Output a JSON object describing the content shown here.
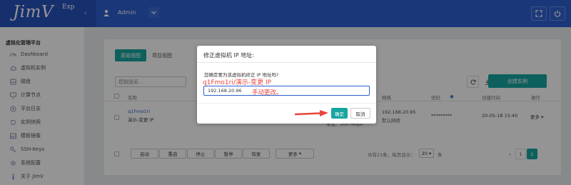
{
  "header": {
    "logo": "JimV",
    "logo_suffix": "Exp",
    "user": "Admin"
  },
  "sidebar": {
    "section": "虚拟化管理平台",
    "items": [
      {
        "label": "Dashboard",
        "icon": "dashboard-icon"
      },
      {
        "label": "虚拟机实例",
        "icon": "cloud-icon"
      },
      {
        "label": "磁盘",
        "icon": "disk-icon"
      },
      {
        "label": "计算节点",
        "icon": "monitor-icon"
      },
      {
        "label": "平台日志",
        "icon": "log-icon"
      },
      {
        "label": "实例快照",
        "icon": "snapshot-icon"
      },
      {
        "label": "模板镜像",
        "icon": "image-icon"
      },
      {
        "label": "SSH-Keys",
        "icon": "key-icon"
      },
      {
        "label": "系统配置",
        "icon": "settings-icon"
      },
      {
        "label": "关于 JimV",
        "icon": "info-icon"
      }
    ]
  },
  "main": {
    "tabs": [
      {
        "label": "原始视图",
        "active": true
      },
      {
        "label": "项目视图",
        "active": false
      }
    ],
    "search_placeholder": "模糊搜索...",
    "create_button": "创建实例",
    "table": {
      "headers": {
        "name": "名称",
        "network": "网络",
        "password": "密码",
        "created": "创建时间",
        "actions": "操作"
      },
      "row": {
        "name_line1": "q1Fmo1ri",
        "name_line2": "演示-变更 IP",
        "bandwidth": "带宽：200 Mbps",
        "ip": "192.168.20.95",
        "network_name": "默认网桥",
        "password": "*********",
        "created": "20-05-18 15:40",
        "more": "更多"
      }
    },
    "footer": {
      "buttons": [
        "启动",
        "重启",
        "停止",
        "暂停",
        "恢复",
        "更多"
      ],
      "total": "共有21条，每页显示：",
      "per_page": "20",
      "per_page_suffix": "条",
      "pages": [
        "‹",
        "1",
        "2"
      ],
      "active_page": "2"
    }
  },
  "modal": {
    "title": "修正虚拟机 IP 地址:",
    "question": "您确定要为该虚拟机修正 IP 地址吗?",
    "annotation_title": "q1Fmo1ri/演示-变更 IP",
    "input_value": "192.168.20.96",
    "annotation_note": "手动更改。",
    "ok": "确定",
    "cancel": "取消"
  },
  "colors": {
    "header": "#2c5fd0",
    "accent": "#17a5a0",
    "annotation": "#e8453c"
  }
}
